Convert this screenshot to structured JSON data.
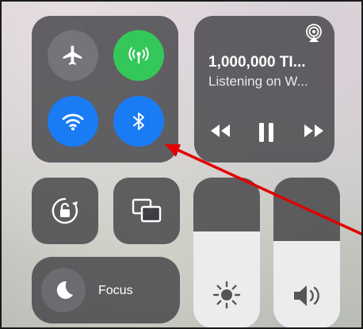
{
  "now_playing": {
    "title": "1,000,000 TI...",
    "source": "Listening on W..."
  },
  "focus": {
    "label": "Focus"
  },
  "brightness": {
    "level": 0.64
  },
  "volume": {
    "level": 0.58
  },
  "toggles": {
    "airplane": false,
    "cellular": true,
    "wifi": true,
    "bluetooth": true
  },
  "colors": {
    "cellular_on": "#34c759",
    "wifi_on": "#1a7cf5",
    "bluetooth_on": "#1a7cf5",
    "annotation_arrow": "#e00000"
  },
  "icons": [
    "airplane-icon",
    "cellular-icon",
    "wifi-icon",
    "bluetooth-icon",
    "airplay-icon",
    "rewind-icon",
    "pause-icon",
    "fast-forward-icon",
    "rotation-lock-icon",
    "screen-mirroring-icon",
    "moon-icon",
    "sun-icon",
    "speaker-icon"
  ]
}
